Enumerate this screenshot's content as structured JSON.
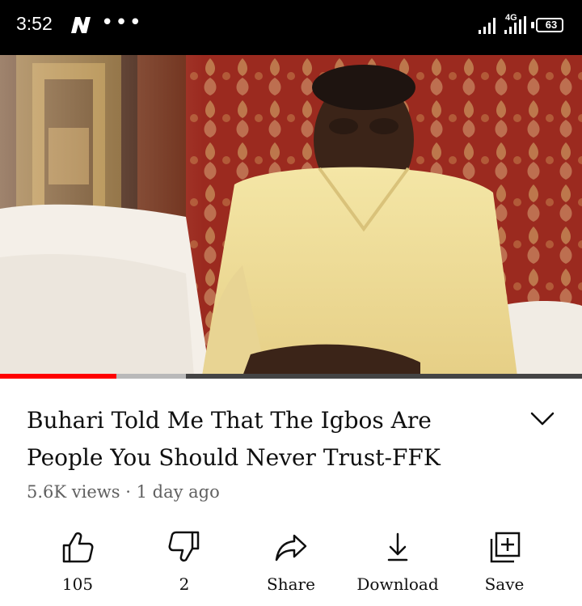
{
  "status_bar": {
    "time": "3:52",
    "notification_icons": [
      "n-app-icon",
      "more-dots-icon"
    ],
    "network_type": "4G",
    "battery_level": "63"
  },
  "video": {
    "progress_played_fraction": 0.2,
    "progress_buffered_fraction": 0.32,
    "progress_color": "#ff0000"
  },
  "details": {
    "title": "Buhari Told Me That The Igbos Are People You Should Never Trust-FFK",
    "views": "5.6K views",
    "separator": "·",
    "age": "1 day ago"
  },
  "actions": [
    {
      "icon": "thumbs-up-icon",
      "label": "105"
    },
    {
      "icon": "thumbs-down-icon",
      "label": "2"
    },
    {
      "icon": "share-icon",
      "label": "Share"
    },
    {
      "icon": "download-icon",
      "label": "Download"
    },
    {
      "icon": "save-playlist-icon",
      "label": "Save"
    }
  ]
}
